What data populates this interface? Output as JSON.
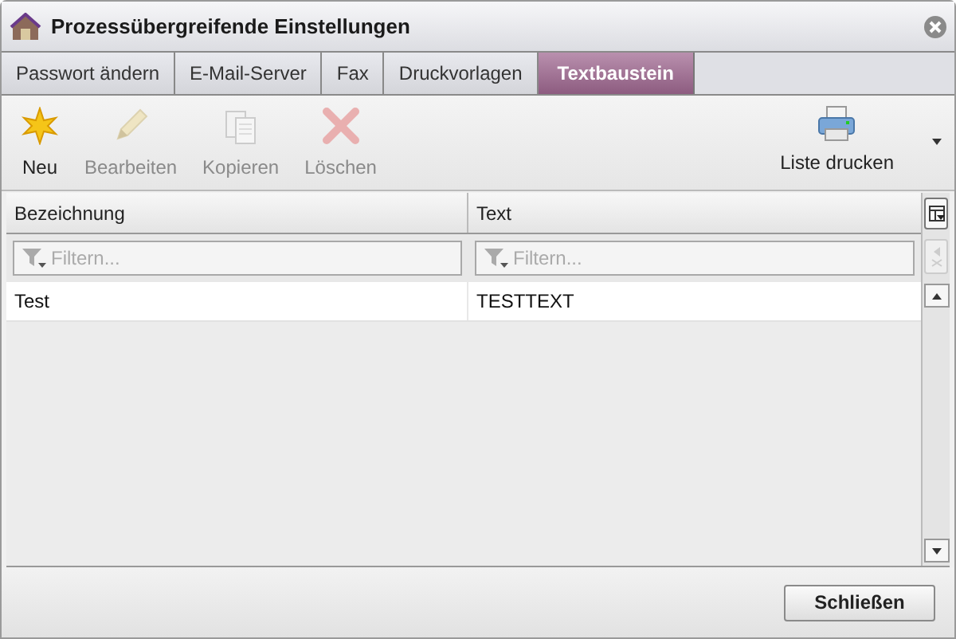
{
  "window": {
    "title": "Prozessübergreifende Einstellungen"
  },
  "tabs": [
    {
      "label": "Passwort ändern",
      "selected": false
    },
    {
      "label": "E-Mail-Server",
      "selected": false
    },
    {
      "label": "Fax",
      "selected": false
    },
    {
      "label": "Druckvorlagen",
      "selected": false
    },
    {
      "label": "Textbaustein",
      "selected": true
    }
  ],
  "toolbar": [
    {
      "kind": "new",
      "label": "Neu",
      "disabled": false
    },
    {
      "kind": "edit",
      "label": "Bearbeiten",
      "disabled": true
    },
    {
      "kind": "copy",
      "label": "Kopieren",
      "disabled": true
    },
    {
      "kind": "delete",
      "label": "Löschen",
      "disabled": true
    }
  ],
  "print_button": {
    "label": "Liste drucken"
  },
  "table": {
    "columns": [
      {
        "label": "Bezeichnung",
        "filter_placeholder": "Filtern..."
      },
      {
        "label": "Text",
        "filter_placeholder": "Filtern..."
      }
    ],
    "rows": [
      [
        "Test",
        "TESTTEXT"
      ]
    ]
  },
  "footer": {
    "buttons": [
      "Schließen"
    ]
  }
}
